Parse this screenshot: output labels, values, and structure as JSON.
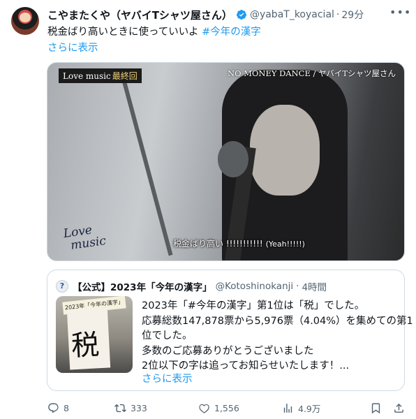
{
  "author": {
    "name": "こやまたくや（ヤバイTシャツ屋さん）",
    "handle": "@yabaT_koyacial",
    "separator": "·",
    "time": "29分"
  },
  "tweet": {
    "text": "税金ばり高いときに使っていいよ",
    "hashtag": "#今年の漢字",
    "show_more": "さらに表示"
  },
  "media": {
    "show_tag": "Love music",
    "show_badge": "最終回",
    "song_credit": "NO MONEY DANCE / ヤバイTシャツ屋さん",
    "logo_line1": "Love",
    "logo_line2": "music",
    "subtitle_jp": "税金ばり高い !!!!!!!!!!!",
    "subtitle_en": "(Yeah!!!!!)"
  },
  "quote": {
    "avatar_letter": "?",
    "name": "【公式】2023年「今年の漢字」",
    "handle": "@Kotoshinokanji",
    "separator": "·",
    "time": "4時間",
    "thumb_banner": "2023年「今年の漢字」",
    "thumb_kanji": "税",
    "lines": [
      "2023年「#今年の漢字」第1位は「税」でした。",
      "応募総数147,878票から5,976票（4.04%）を集めての第1",
      "位でした。",
      "多数のご応募ありがとうございました",
      "2位以下の字は追ってお知らせいたします！..."
    ],
    "show_more": "さらに表示"
  },
  "actions": {
    "replies": "8",
    "retweets": "333",
    "likes": "1,556",
    "views": "4.9万"
  },
  "colors": {
    "accent": "#1d9bf0",
    "secondary_text": "#536471",
    "border": "#cfd9de"
  }
}
